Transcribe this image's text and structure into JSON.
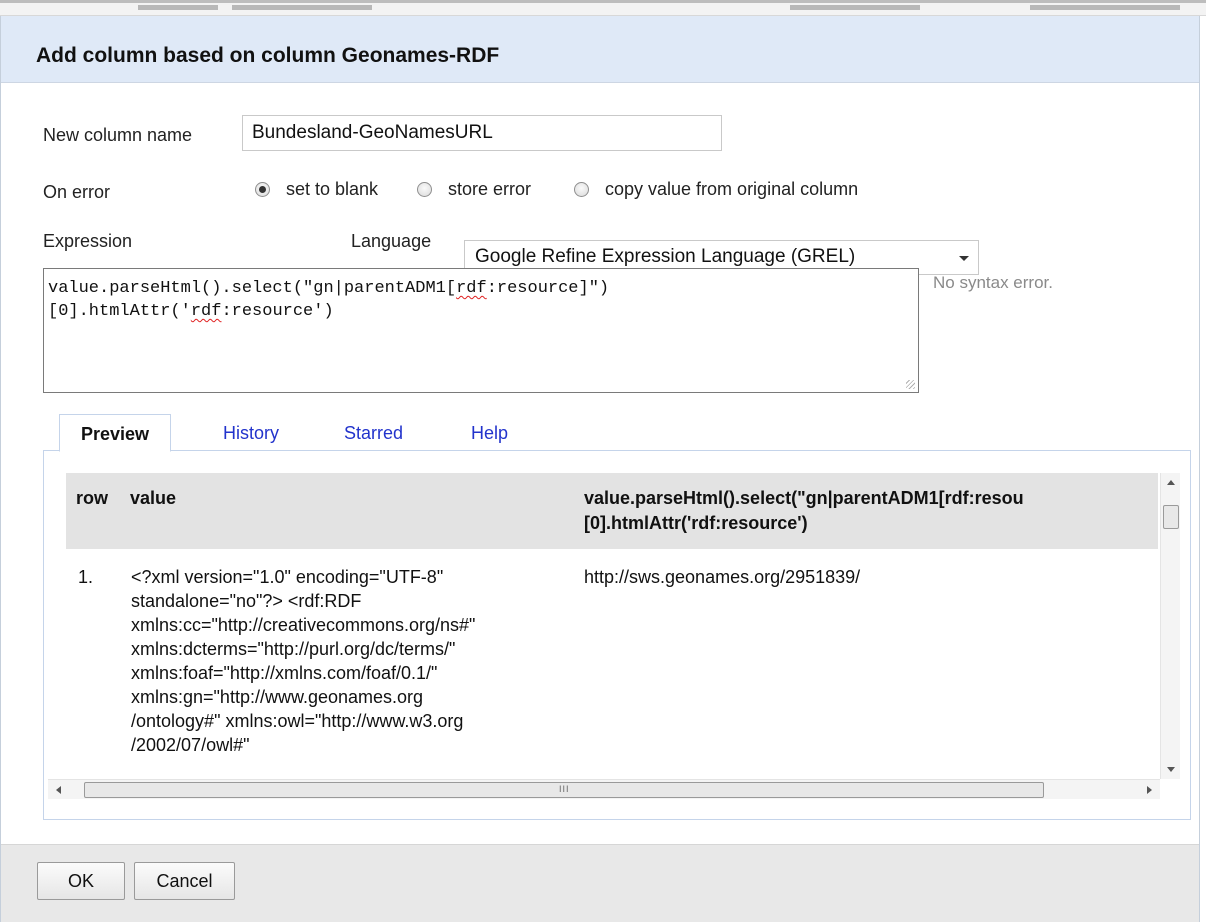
{
  "dialog": {
    "title": "Add column based on column Geonames-RDF"
  },
  "form": {
    "new_column_label": "New column name",
    "new_column_value": "Bundesland-GeoNamesURL",
    "on_error_label": "On error",
    "on_error_options": [
      {
        "label": "set to blank",
        "checked": true
      },
      {
        "label": "store error",
        "checked": false
      },
      {
        "label": "copy value from original column",
        "checked": false
      }
    ],
    "expression_label": "Expression",
    "language_label": "Language",
    "language_value": "Google Refine Expression Language (GREL)"
  },
  "expression": {
    "line1_a": "value.parseHtml().select(\"gn|parentADM1[",
    "line1_b": "rdf",
    "line1_c": ":resource]\")",
    "line2_a": "[0].htmlAttr('",
    "line2_b": "rdf",
    "line2_c": ":resource')",
    "status": "No syntax error."
  },
  "tabs": [
    {
      "label": "Preview",
      "active": true
    },
    {
      "label": "History",
      "active": false
    },
    {
      "label": "Starred",
      "active": false
    },
    {
      "label": "Help",
      "active": false
    }
  ],
  "preview": {
    "headers": {
      "row": "row",
      "value": "value",
      "expr_line1": "value.parseHtml().select(\"gn|parentADM1[rdf:resou",
      "expr_line2": "[0].htmlAttr('rdf:resource')"
    },
    "rows": [
      {
        "row": "1.",
        "value_lines": [
          "<?xml version=\"1.0\" encoding=\"UTF-8\"",
          "standalone=\"no\"?> <rdf:RDF",
          "xmlns:cc=\"http://creativecommons.org/ns#\"",
          "xmlns:dcterms=\"http://purl.org/dc/terms/\"",
          "xmlns:foaf=\"http://xmlns.com/foaf/0.1/\"",
          "xmlns:gn=\"http://www.geonames.org",
          "/ontology#\" xmlns:owl=\"http://www.w3.org",
          "/2002/07/owl#\""
        ],
        "result": "http://sws.geonames.org/2951839/"
      }
    ],
    "hscroll_grip": "III"
  },
  "buttons": {
    "ok": "OK",
    "cancel": "Cancel"
  },
  "colors": {
    "header_bg": "#dfe9f7",
    "link": "#2233cc",
    "squiggle": "#e02020",
    "status": "#8a8a8a"
  }
}
